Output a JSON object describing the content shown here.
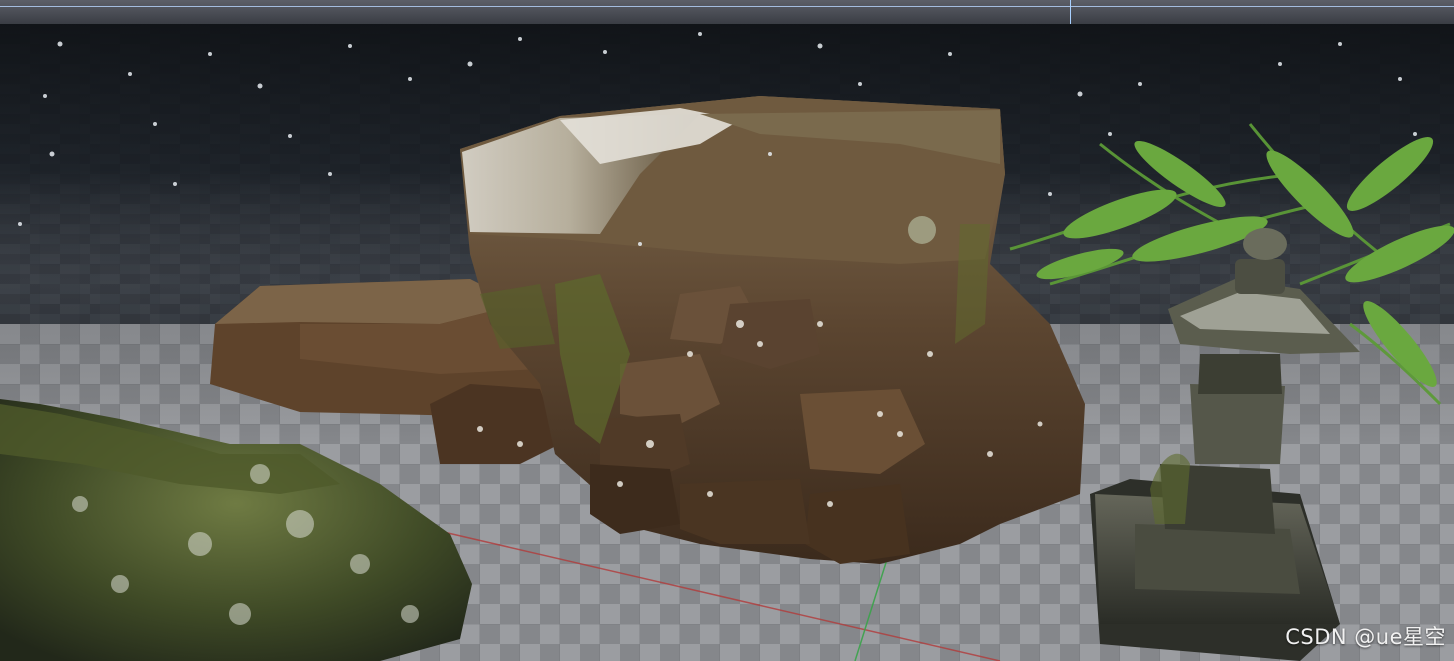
{
  "viewport": {
    "scene_objects": [
      {
        "name": "mossy-rock-formation"
      },
      {
        "name": "mossy-boulder"
      },
      {
        "name": "stone-lantern"
      },
      {
        "name": "fern-plant"
      }
    ],
    "colors": {
      "floor_light": "#9a9c9f",
      "floor_dark": "#1b1f24",
      "rock_main": "#6b4e33",
      "moss": "#4d5a23",
      "snow": "#e9e7e1",
      "fern": "#5e9a3b",
      "axis_x": "#b23b3b",
      "axis_y": "#3aa34a"
    }
  },
  "watermark": {
    "text": "CSDN @ue星空"
  }
}
